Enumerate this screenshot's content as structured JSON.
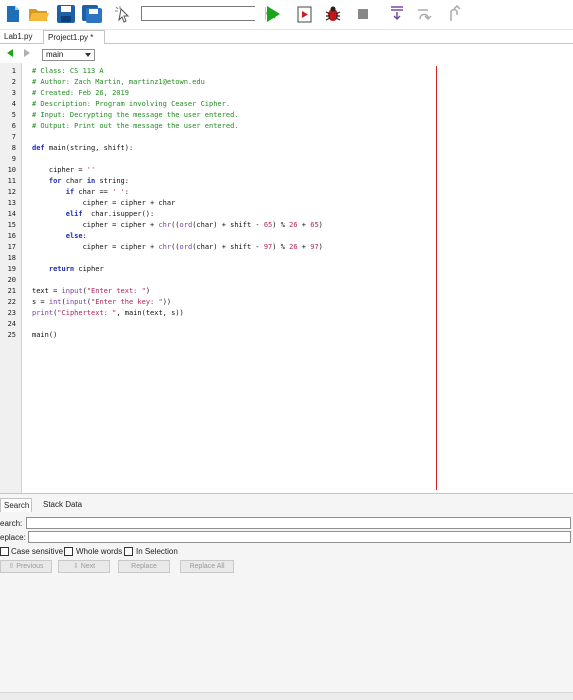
{
  "toolbar": {
    "icons": [
      "new-file-icon",
      "open-folder-icon",
      "save-icon",
      "save-all-icon",
      "pointer-cursor-icon",
      "search-icon",
      "run-icon",
      "step-into-icon",
      "debug-bug-icon",
      "stop-icon",
      "step-down-icon",
      "step-over-icon",
      "step-out-icon"
    ],
    "search_value": ""
  },
  "tabs": [
    {
      "label": "Lab1.py"
    },
    {
      "label": "Project1.py *"
    }
  ],
  "nav": {
    "function_selector": "main"
  },
  "editor": {
    "line_numbers": [
      "1",
      "2",
      "3",
      "4",
      "5",
      "6",
      "7",
      "8",
      "9",
      "10",
      "11",
      "12",
      "13",
      "14",
      "15",
      "16",
      "17",
      "18",
      "19",
      "20",
      "21",
      "22",
      "23",
      "24",
      "25"
    ],
    "lines": [
      "# Class: CS 113 A",
      "# Author: Zach Martin, martinz1@etown.edu",
      "# Created: Feb 26, 2019",
      "# Description: Program involving Ceaser Cipher.",
      "# Input: Decrypting the message the user entered.",
      "# Output: Print out the message the user entered.",
      "",
      "def main(string, shift):",
      "",
      "    cipher = ''",
      "    for char in string:",
      "        if char == ' ':",
      "            cipher = cipher + char",
      "        elif  char.isupper():",
      "            cipher = cipher + chr((ord(char) + shift - 65) % 26 + 65)",
      "        else:",
      "            cipher = cipher + chr((ord(char) + shift - 97) % 26 + 97)",
      "",
      "    return cipher",
      "",
      "text = input(\"Enter text: \")",
      "s = int(input(\"Enter the key: \"))",
      "print(\"Ciphertext: \", main(text, s))",
      "",
      "main()"
    ],
    "margin_color": "#d92020"
  },
  "panel": {
    "tabs": [
      {
        "label": "Search"
      },
      {
        "label": "Stack Data"
      }
    ],
    "search_label": "earch:",
    "replace_label": "eplace:",
    "search_value": "",
    "replace_value": "",
    "options": [
      {
        "label": "Case sensitive",
        "checked": false
      },
      {
        "label": "Whole words",
        "checked": false
      },
      {
        "label": "In Selection",
        "checked": false
      }
    ],
    "buttons": [
      {
        "label": "Previous"
      },
      {
        "label": "Next"
      },
      {
        "label": "Replace"
      },
      {
        "label": "Replace All"
      }
    ]
  },
  "colors": {
    "comment": "#238c23",
    "keyword": "#1e2bb3",
    "builtin": "#7a3fa6",
    "string": "#b3235a",
    "run_green": "#1aa51a"
  }
}
